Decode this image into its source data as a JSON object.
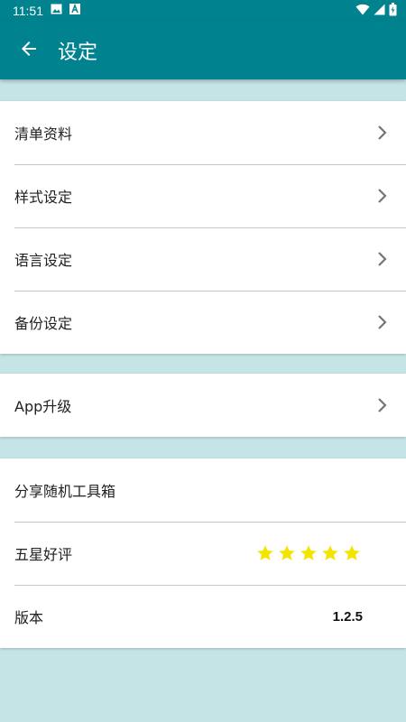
{
  "status_bar": {
    "time": "11:51",
    "left_icons": [
      "image-icon",
      "text-a-icon"
    ],
    "right_icons": [
      "wifi-icon",
      "signal-icon",
      "battery-icon"
    ]
  },
  "app_bar": {
    "title": "设定",
    "back_icon": "arrow-left-icon",
    "background": "#00838f"
  },
  "groups": [
    {
      "items": [
        {
          "label": "清单资料",
          "type": "chevron"
        },
        {
          "label": "样式设定",
          "type": "chevron"
        },
        {
          "label": "语言设定",
          "type": "chevron"
        },
        {
          "label": "备份设定",
          "type": "chevron"
        }
      ]
    },
    {
      "items": [
        {
          "label": "App升级",
          "type": "chevron"
        }
      ]
    },
    {
      "items": [
        {
          "label": "分享随机工具箱",
          "type": "plain"
        },
        {
          "label": "五星好评",
          "type": "rating",
          "rating": 5,
          "rating_max": 5
        },
        {
          "label": "版本",
          "type": "value",
          "value": "1.2.5"
        }
      ]
    }
  ],
  "colors": {
    "accent": "#00838f",
    "page_background": "#c5e4e6",
    "star": "#f5e400"
  }
}
